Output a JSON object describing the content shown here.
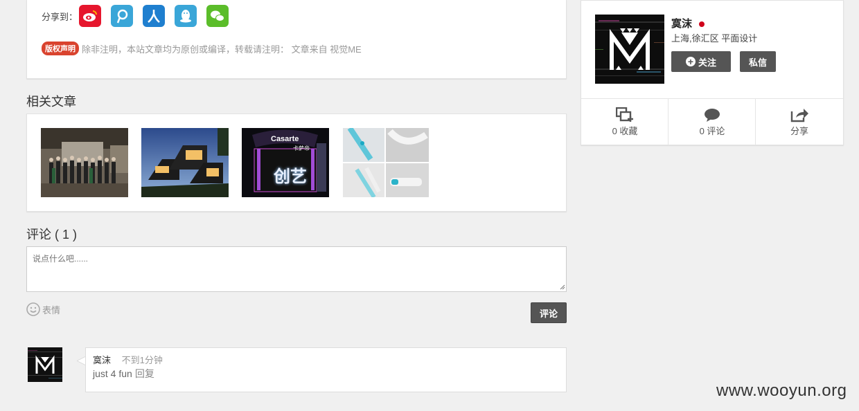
{
  "share": {
    "label": "分享到：",
    "targets": [
      "weibo-icon",
      "tencent-weibo-icon",
      "renren-icon",
      "qq-icon",
      "wechat-icon"
    ]
  },
  "copyright": {
    "badge": "版权声明",
    "text": "除非注明，本站文章均为原创或编译，转载请注明： 文章来自 视觉ME"
  },
  "related": {
    "title": "相关文章",
    "items": [
      {
        "icon": "group-photo-thumbnail"
      },
      {
        "icon": "architecture-thumbnail"
      },
      {
        "icon": "casarte-event-thumbnail",
        "brand": "Casarte",
        "brand_sub": "卡萨帝",
        "caption": "创艺"
      },
      {
        "icon": "product-collage-thumbnail"
      }
    ]
  },
  "comments": {
    "title": "评论 ( 1 )",
    "placeholder": "说点什么吧......",
    "emoji_label": "表情",
    "submit_label": "评论",
    "list": [
      {
        "author": "寞沫",
        "time": "不到1分钟",
        "text": "just 4 fun",
        "reply_label": "回复"
      }
    ]
  },
  "profile": {
    "name": "寞沫",
    "location": "上海,徐汇区 平面设计",
    "follow_label": "关注",
    "message_label": "私信",
    "stats": [
      {
        "icon": "collect-icon",
        "label": "0 收藏"
      },
      {
        "icon": "comment-icon",
        "label": "0 评论"
      },
      {
        "icon": "share-icon",
        "label": "分享"
      }
    ]
  },
  "watermark": "www.wooyun.org",
  "colors": {
    "accent": "#555555",
    "badge": "#d9432e",
    "online": "#d0021b"
  }
}
